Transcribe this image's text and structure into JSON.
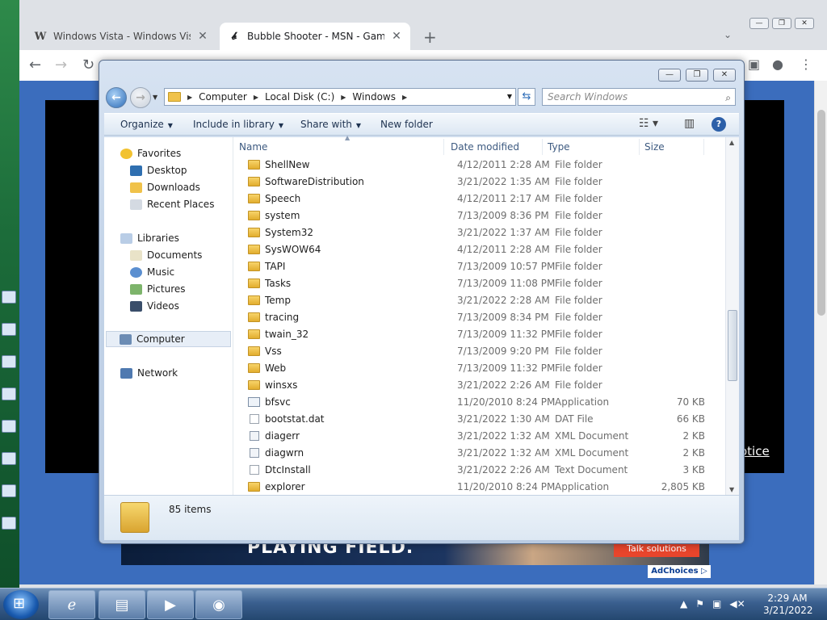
{
  "desktop": {},
  "browser": {
    "tabs": [
      {
        "favicon": "W",
        "title": "Windows Vista - Windows Vista -",
        "active": false
      },
      {
        "favicon": "𝓫",
        "title": "Bubble Shooter - MSN - Game P...",
        "active": true
      }
    ],
    "new_tab": "+",
    "tab_menu": "⌄",
    "controls": [
      "—",
      "❐",
      "✕"
    ],
    "web": {
      "notice_text": "otice",
      "ad_headline": "PLAYING FIELD.",
      "ad_button": "Talk solutions",
      "adchoices": "AdChoices ▷"
    }
  },
  "explorer": {
    "window_controls": [
      "—",
      "❐",
      "✕"
    ],
    "address": {
      "segments": [
        "Computer",
        "Local Disk (C:)",
        "Windows"
      ]
    },
    "search_placeholder": "Search Windows",
    "commands": [
      "Organize",
      "Include in library",
      "Share with",
      "New folder"
    ],
    "nav": {
      "favorites_label": "Favorites",
      "favorites": [
        "Desktop",
        "Downloads",
        "Recent Places"
      ],
      "libraries_label": "Libraries",
      "libraries": [
        "Documents",
        "Music",
        "Pictures",
        "Videos"
      ],
      "computer_label": "Computer",
      "network_label": "Network"
    },
    "columns": [
      "Name",
      "Date modified",
      "Type",
      "Size"
    ],
    "files": [
      {
        "name": "ShellNew",
        "date": "4/12/2011 2:28 AM",
        "type": "File folder",
        "size": "",
        "icon": "folder"
      },
      {
        "name": "SoftwareDistribution",
        "date": "3/21/2022 1:35 AM",
        "type": "File folder",
        "size": "",
        "icon": "folder"
      },
      {
        "name": "Speech",
        "date": "4/12/2011 2:17 AM",
        "type": "File folder",
        "size": "",
        "icon": "folder"
      },
      {
        "name": "system",
        "date": "7/13/2009 8:36 PM",
        "type": "File folder",
        "size": "",
        "icon": "folder"
      },
      {
        "name": "System32",
        "date": "3/21/2022 1:37 AM",
        "type": "File folder",
        "size": "",
        "icon": "folder"
      },
      {
        "name": "SysWOW64",
        "date": "4/12/2011 2:28 AM",
        "type": "File folder",
        "size": "",
        "icon": "folder"
      },
      {
        "name": "TAPI",
        "date": "7/13/2009 10:57 PM",
        "type": "File folder",
        "size": "",
        "icon": "folder"
      },
      {
        "name": "Tasks",
        "date": "7/13/2009 11:08 PM",
        "type": "File folder",
        "size": "",
        "icon": "folder"
      },
      {
        "name": "Temp",
        "date": "3/21/2022 2:28 AM",
        "type": "File folder",
        "size": "",
        "icon": "folder"
      },
      {
        "name": "tracing",
        "date": "7/13/2009 8:34 PM",
        "type": "File folder",
        "size": "",
        "icon": "folder"
      },
      {
        "name": "twain_32",
        "date": "7/13/2009 11:32 PM",
        "type": "File folder",
        "size": "",
        "icon": "folder"
      },
      {
        "name": "Vss",
        "date": "7/13/2009 9:20 PM",
        "type": "File folder",
        "size": "",
        "icon": "folder"
      },
      {
        "name": "Web",
        "date": "7/13/2009 11:32 PM",
        "type": "File folder",
        "size": "",
        "icon": "folder"
      },
      {
        "name": "winsxs",
        "date": "3/21/2022 2:26 AM",
        "type": "File folder",
        "size": "",
        "icon": "folder"
      },
      {
        "name": "bfsvc",
        "date": "11/20/2010 8:24 PM",
        "type": "Application",
        "size": "70 KB",
        "icon": "app"
      },
      {
        "name": "bootstat.dat",
        "date": "3/21/2022 1:30 AM",
        "type": "DAT File",
        "size": "66 KB",
        "icon": "doc"
      },
      {
        "name": "diagerr",
        "date": "3/21/2022 1:32 AM",
        "type": "XML Document",
        "size": "2 KB",
        "icon": "xml"
      },
      {
        "name": "diagwrn",
        "date": "3/21/2022 1:32 AM",
        "type": "XML Document",
        "size": "2 KB",
        "icon": "xml"
      },
      {
        "name": "DtcInstall",
        "date": "3/21/2022 2:26 AM",
        "type": "Text Document",
        "size": "3 KB",
        "icon": "doc"
      },
      {
        "name": "explorer",
        "date": "11/20/2010 8:24 PM",
        "type": "Application",
        "size": "2,805 KB",
        "icon": "folder"
      }
    ],
    "item_count": "85 items"
  },
  "taskbar": {
    "clock_time": "2:29 AM",
    "clock_date": "3/21/2022"
  }
}
